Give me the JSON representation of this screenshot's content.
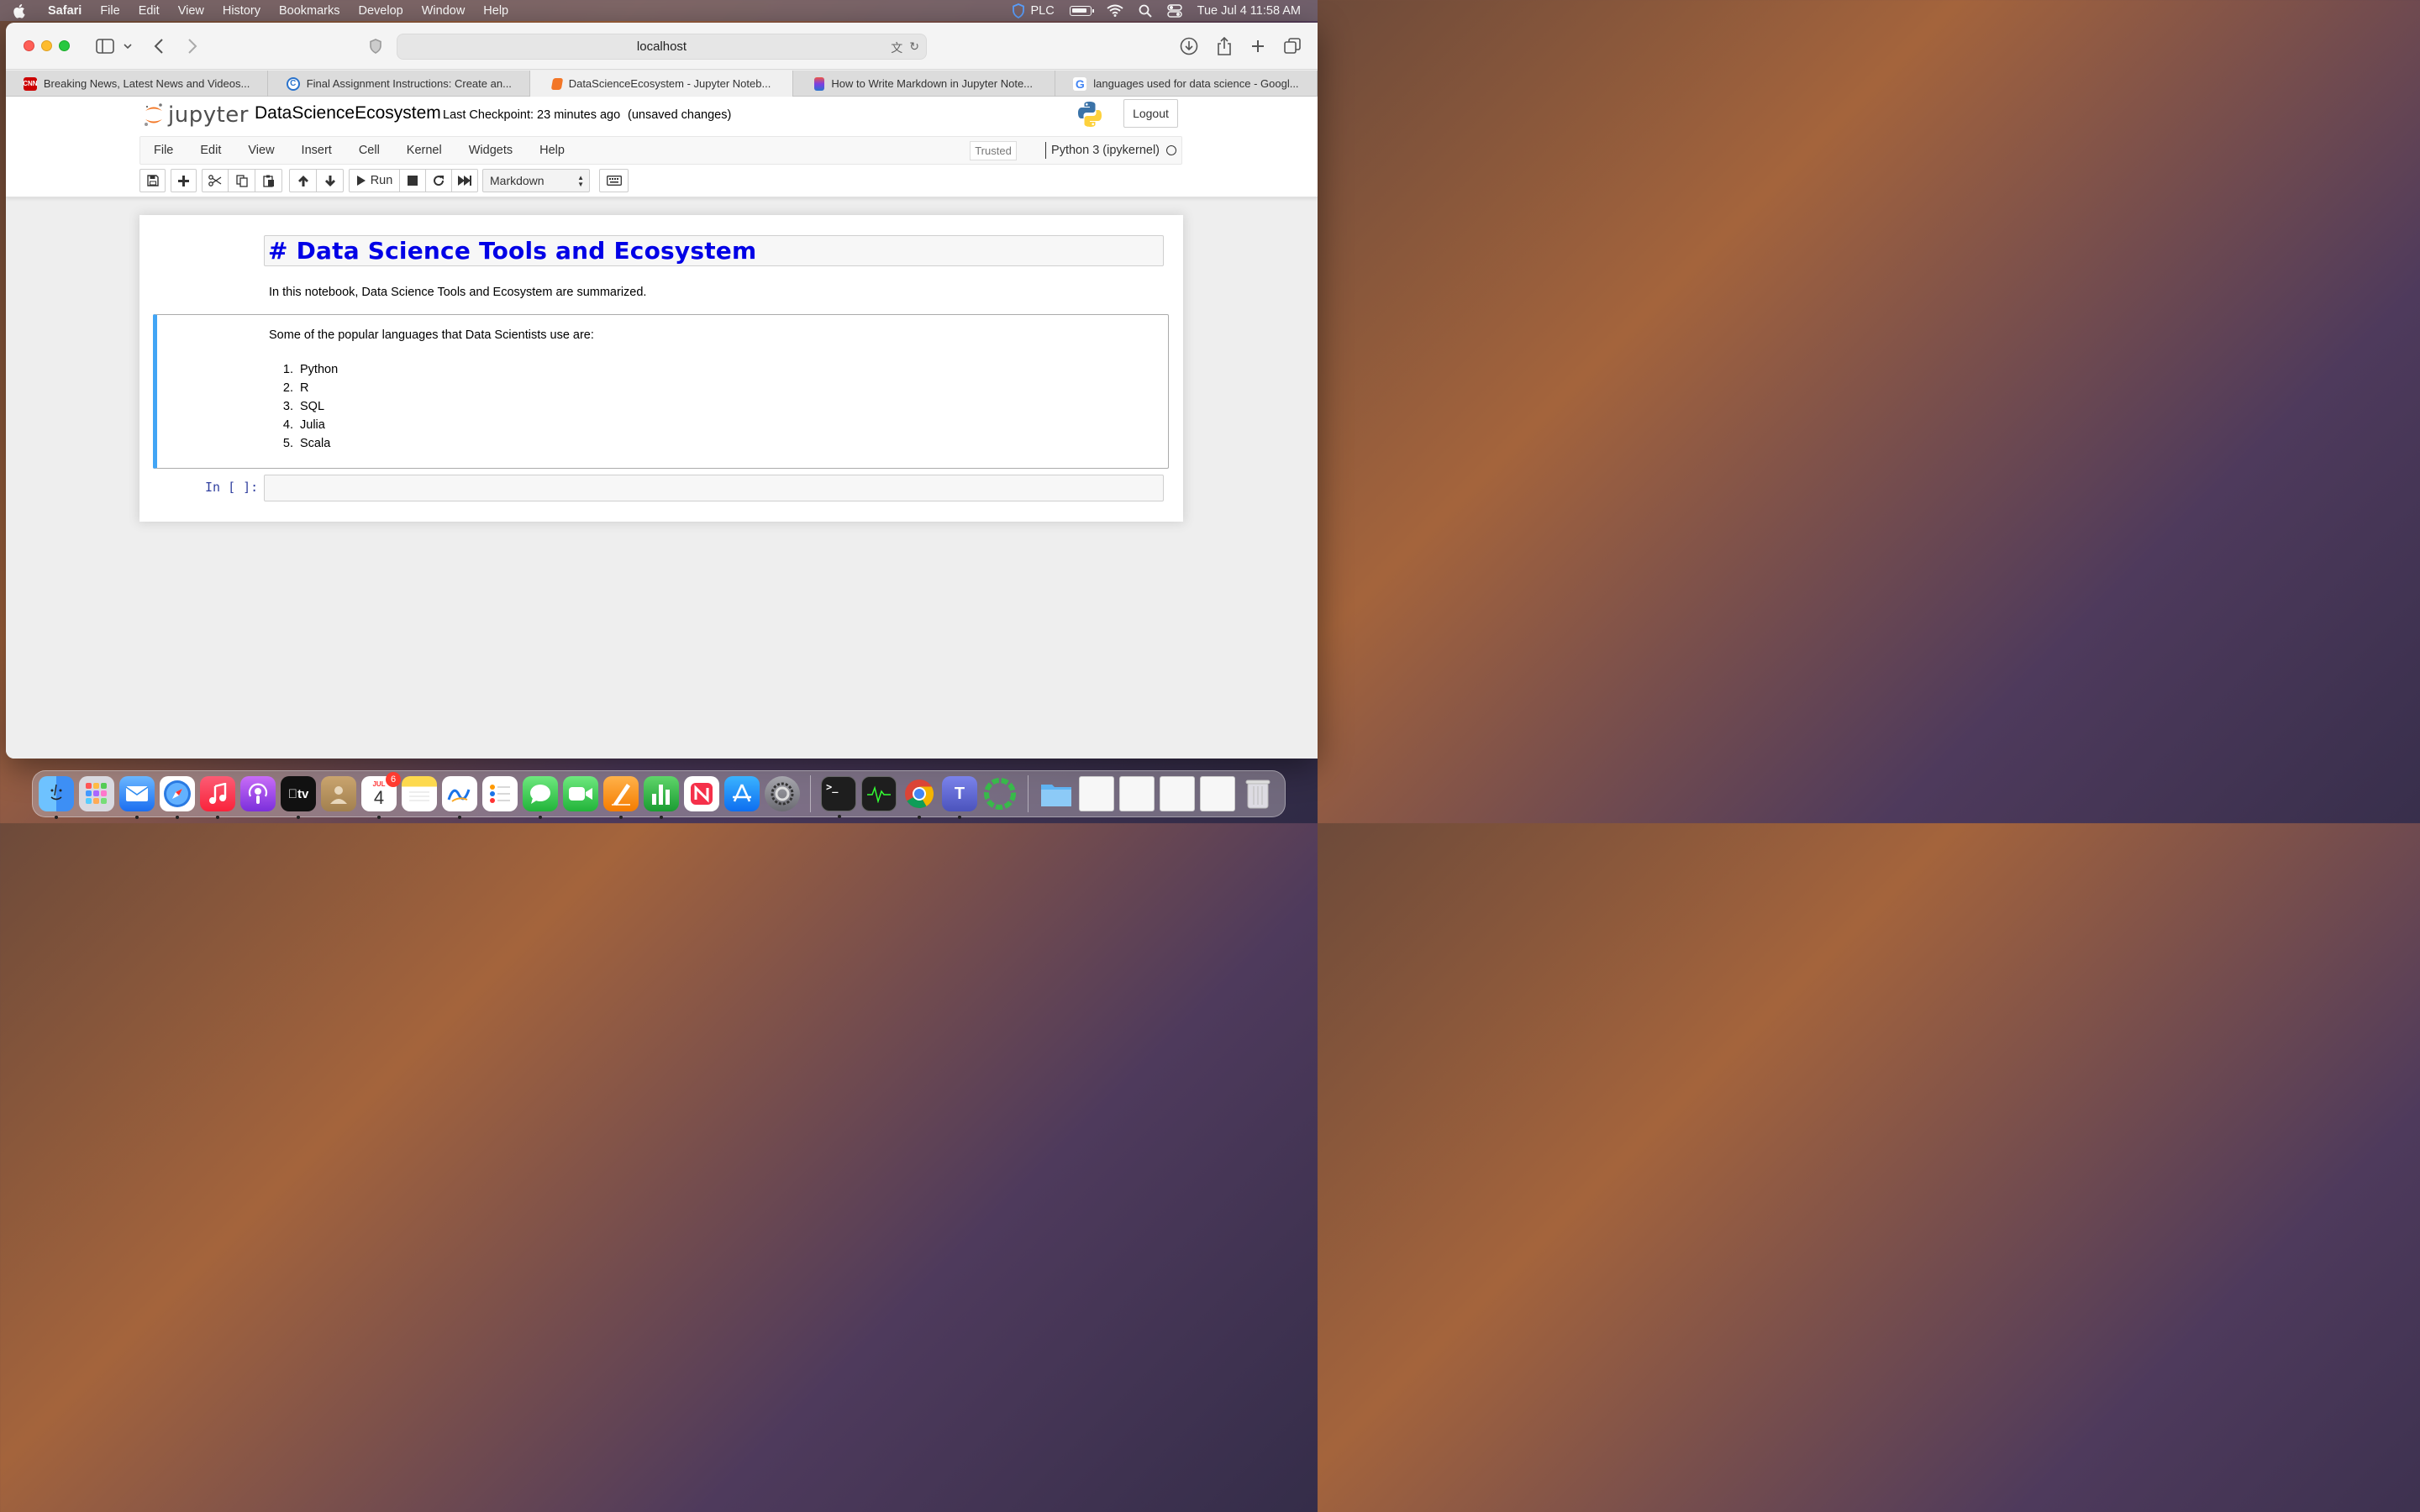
{
  "menubar": {
    "app_name": "Safari",
    "items": [
      "File",
      "Edit",
      "View",
      "History",
      "Bookmarks",
      "Develop",
      "Window",
      "Help"
    ],
    "status_label": "PLC",
    "datetime": "Tue Jul 4  11:58 AM"
  },
  "browser": {
    "url": "localhost",
    "tabs": [
      {
        "title": "Breaking News, Latest News and Videos...",
        "icon": "cnn-icon",
        "favicon_text": "CNN",
        "color": "#cc0000"
      },
      {
        "title": "Final Assignment Instructions: Create an...",
        "icon": "coursera-icon",
        "favicon_text": "C",
        "color": "#2a73cc"
      },
      {
        "title": "DataScienceEcosystem - Jupyter Noteb...",
        "icon": "jupyter-book-icon",
        "favicon_text": "",
        "color": "#f37626"
      },
      {
        "title": "How to Write Markdown in Jupyter Note...",
        "icon": "stack-icon",
        "favicon_text": "",
        "color": "#7b3fe4"
      },
      {
        "title": "languages used for data science - Googl...",
        "icon": "google-icon",
        "favicon_text": "G",
        "color": "#4285f4"
      }
    ],
    "active_tab": 2
  },
  "jupyter": {
    "logo_text": "jupyter",
    "notebook_name": "DataScienceEcosystem",
    "checkpoint": "Last Checkpoint: 23 minutes ago",
    "autosave": "(unsaved changes)",
    "logout_label": "Logout",
    "menu": [
      "File",
      "Edit",
      "View",
      "Insert",
      "Cell",
      "Kernel",
      "Widgets",
      "Help"
    ],
    "trusted_label": "Trusted",
    "kernel_name": "Python 3 (ipykernel)",
    "run_label": "Run",
    "cell_type": "Markdown"
  },
  "cells": {
    "heading_source": "# Data Science Tools and Ecosystem",
    "intro_text": "In this notebook, Data Science Tools and Ecosystem are summarized.",
    "languages_intro": "Some of the popular languages that Data Scientists use are:",
    "languages": [
      "Python",
      "R",
      "SQL",
      "Julia",
      "Scala"
    ],
    "code_prompt": "In [ ]:"
  },
  "dock": {
    "apps": [
      {
        "name": "finder-icon",
        "color": "#3d8ff5"
      },
      {
        "name": "launchpad-icon",
        "color": "#d9d9e0"
      },
      {
        "name": "mail-icon",
        "color": "#2f8cf1"
      },
      {
        "name": "safari-icon",
        "color": "#2a7ae2"
      },
      {
        "name": "music-icon",
        "color": "#f94c57"
      },
      {
        "name": "podcasts-icon",
        "color": "#9b4ae0"
      },
      {
        "name": "tv-icon",
        "color": "#111111"
      },
      {
        "name": "contacts-icon",
        "color": "#b8905e"
      },
      {
        "name": "calendar-icon",
        "color": "#ffffff"
      },
      {
        "name": "notes-icon",
        "color": "#fbd34a"
      },
      {
        "name": "freeform-icon",
        "color": "#ffffff"
      },
      {
        "name": "reminders-icon",
        "color": "#ffffff"
      },
      {
        "name": "messages-icon",
        "color": "#3ccb52"
      },
      {
        "name": "facetime-icon",
        "color": "#34c759"
      },
      {
        "name": "pages-icon",
        "color": "#f79a28"
      },
      {
        "name": "numbers-icon",
        "color": "#33b849"
      },
      {
        "name": "news-icon",
        "color": "#f2f2f2"
      },
      {
        "name": "app-store-icon",
        "color": "#1a8cf5"
      },
      {
        "name": "system-settings-icon",
        "color": "#8c8c93"
      },
      {
        "name": "terminal-icon",
        "color": "#1e1e1e"
      },
      {
        "name": "activity-monitor-icon",
        "color": "#1e1e1e"
      },
      {
        "name": "chrome-icon",
        "color": "#ffffff"
      },
      {
        "name": "teams-icon",
        "color": "#5059c9"
      },
      {
        "name": "app-icon",
        "color": "#38b94a"
      }
    ],
    "calendar_month": "JUL",
    "calendar_day": "4",
    "calendar_badge": "6"
  }
}
